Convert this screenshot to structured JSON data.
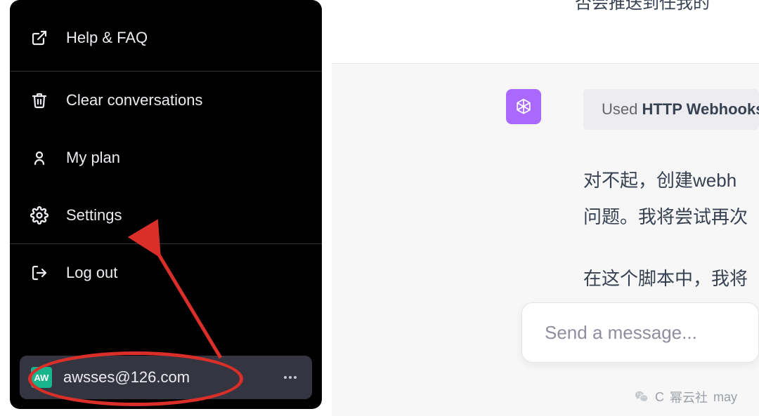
{
  "sidebar": {
    "help_label": "Help & FAQ",
    "clear_label": "Clear conversations",
    "plan_label": "My plan",
    "settings_label": "Settings",
    "logout_label": "Log out"
  },
  "account": {
    "avatar_initials": "AW",
    "email": "awsses@126.com"
  },
  "top_fragment": "否会推送到任我的",
  "plugin": {
    "prefix": "Used ",
    "name": "HTTP Webhooks"
  },
  "reply": {
    "line1": "对不起，创建webh",
    "line2": "问题。我将尝试再次",
    "line3": "在这个脚本中，我将"
  },
  "input_placeholder": "Send a message...",
  "footer_brand": "幂云社",
  "footer_tail": "may"
}
